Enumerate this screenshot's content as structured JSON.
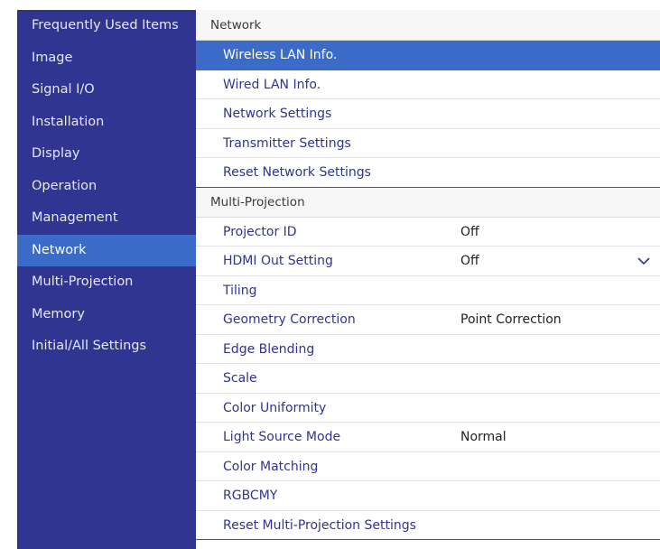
{
  "sidebar": {
    "items": [
      {
        "label": "Frequently Used Items"
      },
      {
        "label": "Image"
      },
      {
        "label": "Signal I/O"
      },
      {
        "label": "Installation"
      },
      {
        "label": "Display"
      },
      {
        "label": "Operation"
      },
      {
        "label": "Management"
      },
      {
        "label": "Network",
        "selected": true
      },
      {
        "label": "Multi-Projection"
      },
      {
        "label": "Memory"
      },
      {
        "label": "Initial/All Settings"
      }
    ]
  },
  "network": {
    "header": "Network",
    "items": [
      {
        "label": "Wireless LAN Info.",
        "selected": true
      },
      {
        "label": "Wired LAN Info."
      },
      {
        "label": "Network Settings"
      },
      {
        "label": "Transmitter Settings"
      },
      {
        "label": "Reset Network Settings"
      }
    ]
  },
  "multi_projection": {
    "header": "Multi-Projection",
    "items": [
      {
        "label": "Projector ID",
        "value": "Off"
      },
      {
        "label": "HDMI Out Setting",
        "value": "Off",
        "icon": "chevron-down-icon"
      },
      {
        "label": "Tiling"
      },
      {
        "label": "Geometry Correction",
        "value": "Point Correction"
      },
      {
        "label": "Edge Blending"
      },
      {
        "label": "Scale"
      },
      {
        "label": "Color Uniformity"
      },
      {
        "label": "Light Source Mode",
        "value": "Normal"
      },
      {
        "label": "Color Matching"
      },
      {
        "label": "RGBCMY"
      },
      {
        "label": "Reset Multi-Projection Settings"
      }
    ]
  },
  "colors": {
    "sidebar_bg": "#2f3590",
    "selection": "#3a6bc8",
    "item_text": "#2f3590"
  }
}
